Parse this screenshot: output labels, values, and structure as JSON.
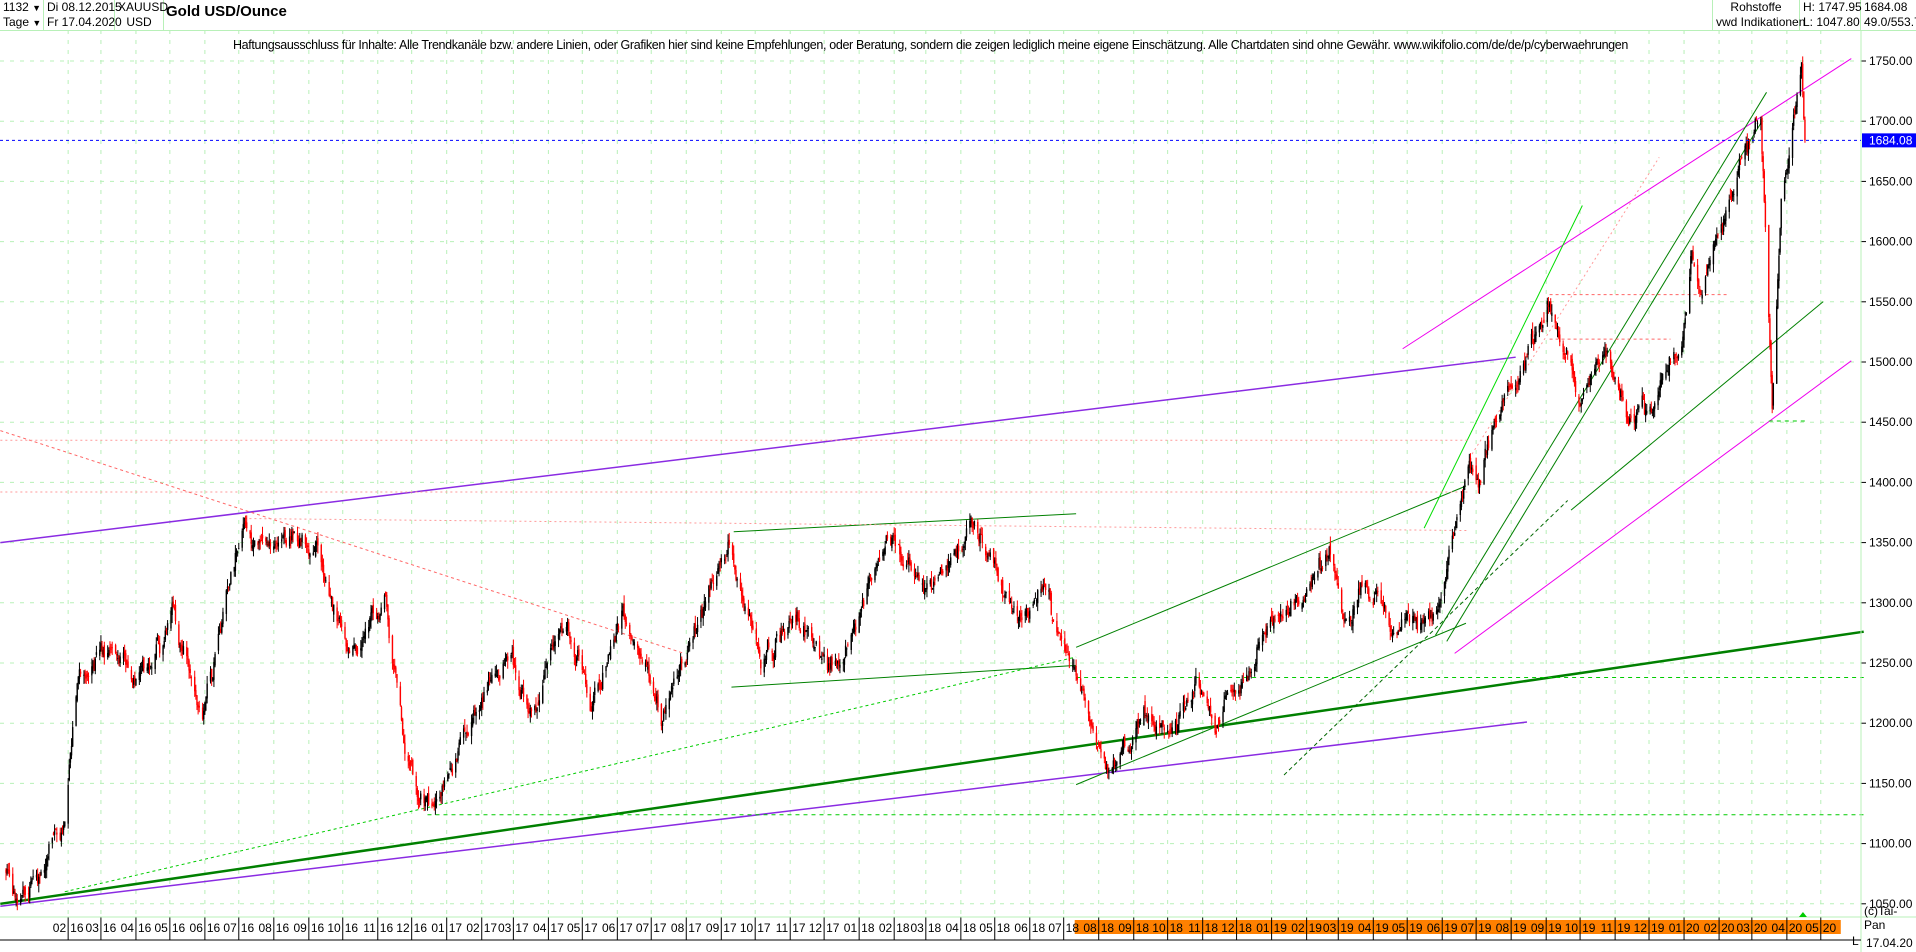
{
  "header": {
    "bars_count": "1132",
    "period": "Tage",
    "date_from": "Di 08.12.2015",
    "date_to": "Fr 17.04.2020",
    "symbol": "XAUUSD",
    "currency": "USD",
    "title": "Gold USD/Ounce",
    "category": "Rohstoffe",
    "source": "vwd Indikationen",
    "high": "H: 1747.95",
    "low": "L: 1047.80",
    "last": "1684.08",
    "scale_info": "49.0/553.7"
  },
  "disclaimer": "Haftungsausschluss für Inhalte: Alle Trendkanäle bzw. andere Linien, oder Grafiken hier sind keine Empfehlungen, oder Beratung, sondern die zeigen lediglich meine eigene Einschätzung. Alle Chartdaten sind ohne Gewähr.  www.wikifolio.com/de/de/p/cyberwaehrungen",
  "footer": {
    "copyright": "(c)Tai-Pan",
    "scale_mode": "L",
    "last_date": "17.04.20"
  },
  "colors": {
    "up": "#000000",
    "down": "#ff0000",
    "grid": "#b8f0b8",
    "current_price": "#0000ff",
    "axis_highlight": "#ff8000"
  },
  "chart_data": {
    "type": "candlestick",
    "title": "Gold USD/Ounce",
    "x_range": [
      "2015-12-08",
      "2020-04-17"
    ],
    "ylim": [
      1040,
      1770
    ],
    "y_ticks": [
      1050,
      1100,
      1150,
      1200,
      1250,
      1300,
      1350,
      1400,
      1450,
      1500,
      1550,
      1600,
      1650,
      1700,
      1750
    ],
    "y_tick_labels": [
      "1050.00",
      "1100.00",
      "1150.00",
      "1200.00",
      "1250.00",
      "1300.00",
      "1350.00",
      "1400.00",
      "1450.00",
      "1500.00",
      "1550.00",
      "1600.00",
      "1650.00",
      "1700.00",
      "1750.00"
    ],
    "x_tick_labels": [
      [
        "02",
        "16"
      ],
      [
        "03",
        "16"
      ],
      [
        "04",
        "16"
      ],
      [
        "05",
        "16"
      ],
      [
        "06",
        "16"
      ],
      [
        "07",
        "16"
      ],
      [
        "08",
        "16"
      ],
      [
        "09",
        "16"
      ],
      [
        "10",
        "16"
      ],
      [
        "11",
        "16"
      ],
      [
        "12",
        "16"
      ],
      [
        "01",
        "17"
      ],
      [
        "02",
        "17"
      ],
      [
        "03",
        "17"
      ],
      [
        "04",
        "17"
      ],
      [
        "05",
        "17"
      ],
      [
        "06",
        "17"
      ],
      [
        "07",
        "17"
      ],
      [
        "08",
        "17"
      ],
      [
        "09",
        "17"
      ],
      [
        "10",
        "17"
      ],
      [
        "11",
        "17"
      ],
      [
        "12",
        "17"
      ],
      [
        "01",
        "18"
      ],
      [
        "02",
        "18"
      ],
      [
        "03",
        "18"
      ],
      [
        "04",
        "18"
      ],
      [
        "05",
        "18"
      ],
      [
        "06",
        "18"
      ],
      [
        "07",
        "18"
      ],
      [
        "08",
        "18"
      ],
      [
        "09",
        "18"
      ],
      [
        "10",
        "18"
      ],
      [
        "11",
        "18"
      ],
      [
        "12",
        "18"
      ],
      [
        "01",
        "19"
      ],
      [
        "02",
        "19"
      ],
      [
        "03",
        "19"
      ],
      [
        "04",
        "19"
      ],
      [
        "05",
        "19"
      ],
      [
        "06",
        "19"
      ],
      [
        "07",
        "19"
      ],
      [
        "08",
        "19"
      ],
      [
        "09",
        "19"
      ],
      [
        "10",
        "19"
      ],
      [
        "11",
        "19"
      ],
      [
        "12",
        "19"
      ],
      [
        "01",
        "20"
      ],
      [
        "02",
        "20"
      ],
      [
        "03",
        "20"
      ],
      [
        "04",
        "20"
      ],
      [
        "05",
        "20"
      ]
    ],
    "highlighted_from": "2018-08",
    "grid": true,
    "current_price": 1684.08,
    "current_price_label": "1684.08",
    "high": 1747.95,
    "low": 1047.8,
    "close_path": [
      [
        "2015-12-08",
        1075
      ],
      [
        "2015-12-17",
        1050
      ],
      [
        "2016-01-29",
        1115
      ],
      [
        "2016-02-11",
        1245
      ],
      [
        "2016-03-10",
        1270
      ],
      [
        "2016-04-01",
        1220
      ],
      [
        "2016-05-02",
        1295
      ],
      [
        "2016-05-30",
        1205
      ],
      [
        "2016-06-24",
        1320
      ],
      [
        "2016-07-06",
        1370
      ],
      [
        "2016-08-01",
        1350
      ],
      [
        "2016-09-07",
        1350
      ],
      [
        "2016-10-07",
        1255
      ],
      [
        "2016-11-08",
        1300
      ],
      [
        "2016-11-25",
        1180
      ],
      [
        "2016-12-15",
        1125
      ],
      [
        "2017-01-31",
        1210
      ],
      [
        "2017-02-27",
        1255
      ],
      [
        "2017-03-15",
        1200
      ],
      [
        "2017-04-17",
        1290
      ],
      [
        "2017-05-09",
        1215
      ],
      [
        "2017-06-06",
        1295
      ],
      [
        "2017-07-10",
        1205
      ],
      [
        "2017-09-08",
        1350
      ],
      [
        "2017-10-06",
        1260
      ],
      [
        "2017-11-08",
        1285
      ],
      [
        "2017-12-12",
        1240
      ],
      [
        "2018-01-25",
        1360
      ],
      [
        "2018-03-01",
        1310
      ],
      [
        "2018-04-11",
        1365
      ],
      [
        "2018-05-21",
        1290
      ],
      [
        "2018-06-14",
        1305
      ],
      [
        "2018-07-19",
        1220
      ],
      [
        "2018-08-16",
        1160
      ],
      [
        "2018-09-10",
        1200
      ],
      [
        "2018-10-01",
        1185
      ],
      [
        "2018-10-26",
        1240
      ],
      [
        "2018-11-13",
        1200
      ],
      [
        "2018-12-31",
        1280
      ],
      [
        "2019-02-20",
        1345
      ],
      [
        "2019-03-07",
        1285
      ],
      [
        "2019-03-25",
        1320
      ],
      [
        "2019-04-23",
        1270
      ],
      [
        "2019-05-31",
        1305
      ],
      [
        "2019-06-25",
        1420
      ],
      [
        "2019-07-05",
        1390
      ],
      [
        "2019-07-18",
        1450
      ],
      [
        "2019-08-30",
        1530
      ],
      [
        "2019-09-04",
        1555
      ],
      [
        "2019-10-01",
        1470
      ],
      [
        "2019-10-25",
        1505
      ],
      [
        "2019-11-12",
        1450
      ],
      [
        "2019-12-03",
        1465
      ],
      [
        "2019-12-31",
        1520
      ],
      [
        "2020-01-08",
        1600
      ],
      [
        "2020-01-16",
        1550
      ],
      [
        "2020-02-24",
        1680
      ],
      [
        "2020-03-09",
        1700
      ],
      [
        "2020-03-19",
        1455
      ],
      [
        "2020-03-27",
        1630
      ],
      [
        "2020-04-14",
        1745
      ],
      [
        "2020-04-17",
        1684.08
      ]
    ],
    "trendlines": [
      {
        "color": "#8a2be2",
        "width": 1.5,
        "dash": "",
        "from": [
          "2015-12-03",
          1350
        ],
        "to": [
          "2019-08-05",
          1504
        ]
      },
      {
        "color": "#8a2be2",
        "width": 1.5,
        "dash": "",
        "from": [
          "2015-12-03",
          1048
        ],
        "to": [
          "2019-08-15",
          1201
        ]
      },
      {
        "color": "#008000",
        "width": 2.5,
        "dash": "",
        "from": [
          "2015-12-03",
          1050
        ],
        "to": [
          "2020-06-08",
          1276
        ]
      },
      {
        "color": "#ee00ee",
        "width": 1,
        "dash": "",
        "from": [
          "2019-04-27",
          1511
        ],
        "to": [
          "2020-05-28",
          1752
        ]
      },
      {
        "color": "#ee00ee",
        "width": 1,
        "dash": "",
        "from": [
          "2019-06-12",
          1258
        ],
        "to": [
          "2020-05-28",
          1501
        ]
      },
      {
        "color": "#008000",
        "width": 1,
        "dash": "",
        "from": [
          "2018-07-12",
          1149
        ],
        "to": [
          "2019-06-22",
          1283
        ]
      },
      {
        "color": "#008000",
        "width": 1,
        "dash": "",
        "from": [
          "2018-07-12",
          1263
        ],
        "to": [
          "2019-06-22",
          1397
        ]
      },
      {
        "color": "#008000",
        "width": 1,
        "dash": "",
        "from": [
          "2017-09-12",
          1359
        ],
        "to": [
          "2018-07-12",
          1374
        ]
      },
      {
        "color": "#008000",
        "width": 1,
        "dash": "",
        "from": [
          "2017-09-10",
          1230
        ],
        "to": [
          "2018-07-12",
          1248
        ]
      },
      {
        "color": "#00dd00",
        "width": 1,
        "dash": "",
        "from": [
          "2019-05-16",
          1362
        ],
        "to": [
          "2019-10-03",
          1630
        ]
      },
      {
        "color": "#008000",
        "width": 1,
        "dash": "",
        "from": [
          "2019-05-26",
          1273
        ],
        "to": [
          "2020-03-14",
          1724
        ]
      },
      {
        "color": "#008000",
        "width": 1,
        "dash": "",
        "from": [
          "2019-09-23",
          1377
        ],
        "to": [
          "2020-05-03",
          1550
        ]
      },
      {
        "color": "#008000",
        "width": 1,
        "dash": "",
        "from": [
          "2019-06-05",
          1268
        ],
        "to": [
          "2020-03-10",
          1700
        ]
      },
      {
        "color": "#ff6666",
        "width": 1,
        "dash": "3,3",
        "from": [
          "2015-12-03",
          1443
        ],
        "to": [
          "2017-07-30",
          1258
        ]
      },
      {
        "color": "#ff9999",
        "width": 1,
        "dash": "2,3",
        "from": [
          "2015-12-03",
          1435
        ],
        "to": [
          "2019-06-25",
          1435
        ]
      },
      {
        "color": "#ff9999",
        "width": 1,
        "dash": "2,3",
        "from": [
          "2015-12-03",
          1392
        ],
        "to": [
          "2019-06-25",
          1392
        ]
      },
      {
        "color": "#ff9999",
        "width": 1,
        "dash": "2,3",
        "from": [
          "2016-07-06",
          1370
        ],
        "to": [
          "2019-06-25",
          1360
        ]
      },
      {
        "color": "#ff6666",
        "width": 1,
        "dash": "3,3",
        "from": [
          "2019-09-04",
          1556
        ],
        "to": [
          "2020-02-10",
          1556
        ]
      },
      {
        "color": "#ff6666",
        "width": 1,
        "dash": "3,3",
        "from": [
          "2019-09-04",
          1519
        ],
        "to": [
          "2019-12-20",
          1519
        ]
      },
      {
        "color": "#ff9999",
        "width": 1,
        "dash": "2,3",
        "from": [
          "2019-06-25",
          1420
        ],
        "to": [
          "2019-12-10",
          1670
        ]
      },
      {
        "color": "#00cc00",
        "width": 1,
        "dash": "4,4",
        "from": [
          "2018-07-12",
          1238
        ],
        "to": [
          "2020-06-08",
          1238
        ]
      },
      {
        "color": "#00cc00",
        "width": 1,
        "dash": "4,4",
        "from": [
          "2016-12-15",
          1124
        ],
        "to": [
          "2020-06-08",
          1124
        ]
      },
      {
        "color": "#00cc00",
        "width": 1,
        "dash": "4,4",
        "from": [
          "2020-03-16",
          1451
        ],
        "to": [
          "2020-04-20",
          1451
        ]
      },
      {
        "color": "#00cc00",
        "width": 1,
        "dash": "3,3",
        "from": [
          "2016-01-29",
          1060
        ],
        "to": [
          "2018-07-12",
          1255
        ]
      },
      {
        "color": "#006600",
        "width": 1,
        "dash": "4,3",
        "from": [
          "2019-01-12",
          1157
        ],
        "to": [
          "2019-09-20",
          1385
        ]
      }
    ]
  }
}
